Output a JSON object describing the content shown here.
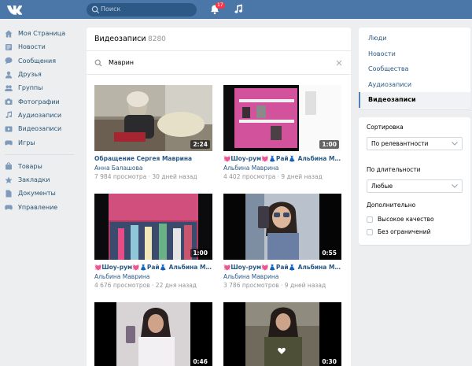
{
  "header": {
    "search_placeholder": "Поиск",
    "notifications_count": "17"
  },
  "sidebar": {
    "items": [
      {
        "label": "Моя Страница",
        "icon": "home-icon"
      },
      {
        "label": "Новости",
        "icon": "news-icon"
      },
      {
        "label": "Сообщения",
        "icon": "messages-icon"
      },
      {
        "label": "Друзья",
        "icon": "friends-icon"
      },
      {
        "label": "Группы",
        "icon": "groups-icon"
      },
      {
        "label": "Фотографии",
        "icon": "camera-icon"
      },
      {
        "label": "Аудиозаписи",
        "icon": "music-icon"
      },
      {
        "label": "Видеозаписи",
        "icon": "video-icon"
      },
      {
        "label": "Игры",
        "icon": "gamepad-icon"
      }
    ],
    "items2": [
      {
        "label": "Товары",
        "icon": "bag-icon"
      },
      {
        "label": "Закладки",
        "icon": "star-icon"
      },
      {
        "label": "Документы",
        "icon": "document-icon"
      },
      {
        "label": "Управление",
        "icon": "gamepad-icon"
      }
    ]
  },
  "main": {
    "title": "Видеозаписи",
    "count": "8280",
    "query": "Маврин",
    "videos": [
      {
        "duration": "2:24",
        "title": "Обращение Сергея Маврина",
        "author": "Анна Балашова",
        "views": "7 984 просмотра",
        "age": "30 дней назад"
      },
      {
        "duration": "1:00",
        "title": "💓Шоу-рум💓👗Рай👗 Альбина Маврина",
        "author": "Альбина Маврина",
        "views": "4 402 просмотра",
        "age": "9 дней назад"
      },
      {
        "duration": "1:00",
        "title": "💓Шоу-рум💓👗Рай👗 Альбина Маври...",
        "author": "Альбина Маврина",
        "views": "4 676 просмотров",
        "age": "22 дня назад"
      },
      {
        "duration": "0:55",
        "title": "💓Шоу-рум💓👗Рай👗 Альбина Маврина",
        "author": "Альбина Маврина",
        "views": "3 786 просмотров",
        "age": "9 дней назад"
      },
      {
        "duration": "0:46"
      },
      {
        "duration": "0:30"
      }
    ]
  },
  "right_nav": {
    "items": [
      "Люди",
      "Новости",
      "Сообщества",
      "Аудиозаписи",
      "Видеозаписи"
    ],
    "active": "Видеозаписи"
  },
  "filters": {
    "sort_heading": "Сортировка",
    "sort_value": "По релевантности",
    "length_heading": "По длительности",
    "length_value": "Любые",
    "extra_heading": "Дополнительно",
    "hq_label": "Высокое качество",
    "safe_label": "Без ограничений"
  },
  "colors": {
    "header_bg": "#4a76a8",
    "link": "#2a5885",
    "badge": "#ff3347"
  }
}
